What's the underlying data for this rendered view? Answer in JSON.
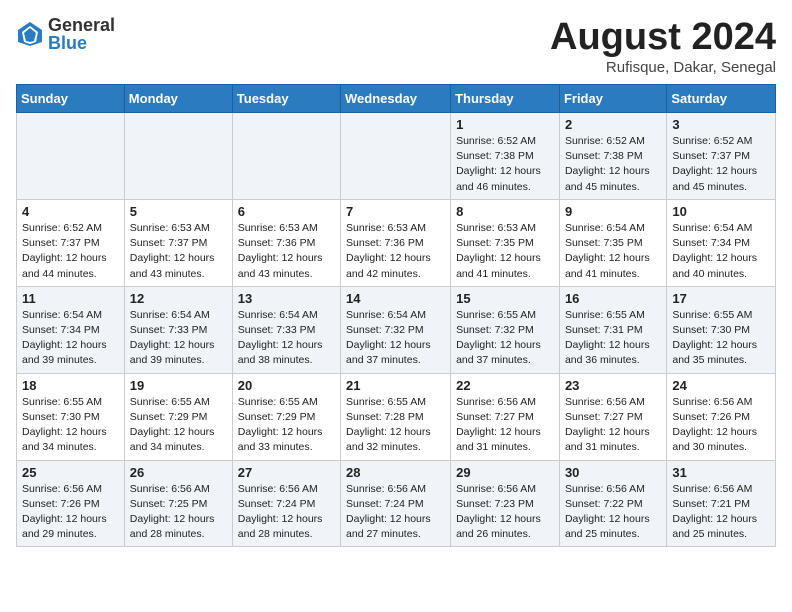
{
  "logo": {
    "general": "General",
    "blue": "Blue"
  },
  "title": "August 2024",
  "location": "Rufisque, Dakar, Senegal",
  "days_of_week": [
    "Sunday",
    "Monday",
    "Tuesday",
    "Wednesday",
    "Thursday",
    "Friday",
    "Saturday"
  ],
  "weeks": [
    [
      {
        "day": "",
        "info": ""
      },
      {
        "day": "",
        "info": ""
      },
      {
        "day": "",
        "info": ""
      },
      {
        "day": "",
        "info": ""
      },
      {
        "day": "1",
        "info": "Sunrise: 6:52 AM\nSunset: 7:38 PM\nDaylight: 12 hours\nand 46 minutes."
      },
      {
        "day": "2",
        "info": "Sunrise: 6:52 AM\nSunset: 7:38 PM\nDaylight: 12 hours\nand 45 minutes."
      },
      {
        "day": "3",
        "info": "Sunrise: 6:52 AM\nSunset: 7:37 PM\nDaylight: 12 hours\nand 45 minutes."
      }
    ],
    [
      {
        "day": "4",
        "info": "Sunrise: 6:52 AM\nSunset: 7:37 PM\nDaylight: 12 hours\nand 44 minutes."
      },
      {
        "day": "5",
        "info": "Sunrise: 6:53 AM\nSunset: 7:37 PM\nDaylight: 12 hours\nand 43 minutes."
      },
      {
        "day": "6",
        "info": "Sunrise: 6:53 AM\nSunset: 7:36 PM\nDaylight: 12 hours\nand 43 minutes."
      },
      {
        "day": "7",
        "info": "Sunrise: 6:53 AM\nSunset: 7:36 PM\nDaylight: 12 hours\nand 42 minutes."
      },
      {
        "day": "8",
        "info": "Sunrise: 6:53 AM\nSunset: 7:35 PM\nDaylight: 12 hours\nand 41 minutes."
      },
      {
        "day": "9",
        "info": "Sunrise: 6:54 AM\nSunset: 7:35 PM\nDaylight: 12 hours\nand 41 minutes."
      },
      {
        "day": "10",
        "info": "Sunrise: 6:54 AM\nSunset: 7:34 PM\nDaylight: 12 hours\nand 40 minutes."
      }
    ],
    [
      {
        "day": "11",
        "info": "Sunrise: 6:54 AM\nSunset: 7:34 PM\nDaylight: 12 hours\nand 39 minutes."
      },
      {
        "day": "12",
        "info": "Sunrise: 6:54 AM\nSunset: 7:33 PM\nDaylight: 12 hours\nand 39 minutes."
      },
      {
        "day": "13",
        "info": "Sunrise: 6:54 AM\nSunset: 7:33 PM\nDaylight: 12 hours\nand 38 minutes."
      },
      {
        "day": "14",
        "info": "Sunrise: 6:54 AM\nSunset: 7:32 PM\nDaylight: 12 hours\nand 37 minutes."
      },
      {
        "day": "15",
        "info": "Sunrise: 6:55 AM\nSunset: 7:32 PM\nDaylight: 12 hours\nand 37 minutes."
      },
      {
        "day": "16",
        "info": "Sunrise: 6:55 AM\nSunset: 7:31 PM\nDaylight: 12 hours\nand 36 minutes."
      },
      {
        "day": "17",
        "info": "Sunrise: 6:55 AM\nSunset: 7:30 PM\nDaylight: 12 hours\nand 35 minutes."
      }
    ],
    [
      {
        "day": "18",
        "info": "Sunrise: 6:55 AM\nSunset: 7:30 PM\nDaylight: 12 hours\nand 34 minutes."
      },
      {
        "day": "19",
        "info": "Sunrise: 6:55 AM\nSunset: 7:29 PM\nDaylight: 12 hours\nand 34 minutes."
      },
      {
        "day": "20",
        "info": "Sunrise: 6:55 AM\nSunset: 7:29 PM\nDaylight: 12 hours\nand 33 minutes."
      },
      {
        "day": "21",
        "info": "Sunrise: 6:55 AM\nSunset: 7:28 PM\nDaylight: 12 hours\nand 32 minutes."
      },
      {
        "day": "22",
        "info": "Sunrise: 6:56 AM\nSunset: 7:27 PM\nDaylight: 12 hours\nand 31 minutes."
      },
      {
        "day": "23",
        "info": "Sunrise: 6:56 AM\nSunset: 7:27 PM\nDaylight: 12 hours\nand 31 minutes."
      },
      {
        "day": "24",
        "info": "Sunrise: 6:56 AM\nSunset: 7:26 PM\nDaylight: 12 hours\nand 30 minutes."
      }
    ],
    [
      {
        "day": "25",
        "info": "Sunrise: 6:56 AM\nSunset: 7:26 PM\nDaylight: 12 hours\nand 29 minutes."
      },
      {
        "day": "26",
        "info": "Sunrise: 6:56 AM\nSunset: 7:25 PM\nDaylight: 12 hours\nand 28 minutes."
      },
      {
        "day": "27",
        "info": "Sunrise: 6:56 AM\nSunset: 7:24 PM\nDaylight: 12 hours\nand 28 minutes."
      },
      {
        "day": "28",
        "info": "Sunrise: 6:56 AM\nSunset: 7:24 PM\nDaylight: 12 hours\nand 27 minutes."
      },
      {
        "day": "29",
        "info": "Sunrise: 6:56 AM\nSunset: 7:23 PM\nDaylight: 12 hours\nand 26 minutes."
      },
      {
        "day": "30",
        "info": "Sunrise: 6:56 AM\nSunset: 7:22 PM\nDaylight: 12 hours\nand 25 minutes."
      },
      {
        "day": "31",
        "info": "Sunrise: 6:56 AM\nSunset: 7:21 PM\nDaylight: 12 hours\nand 25 minutes."
      }
    ]
  ]
}
